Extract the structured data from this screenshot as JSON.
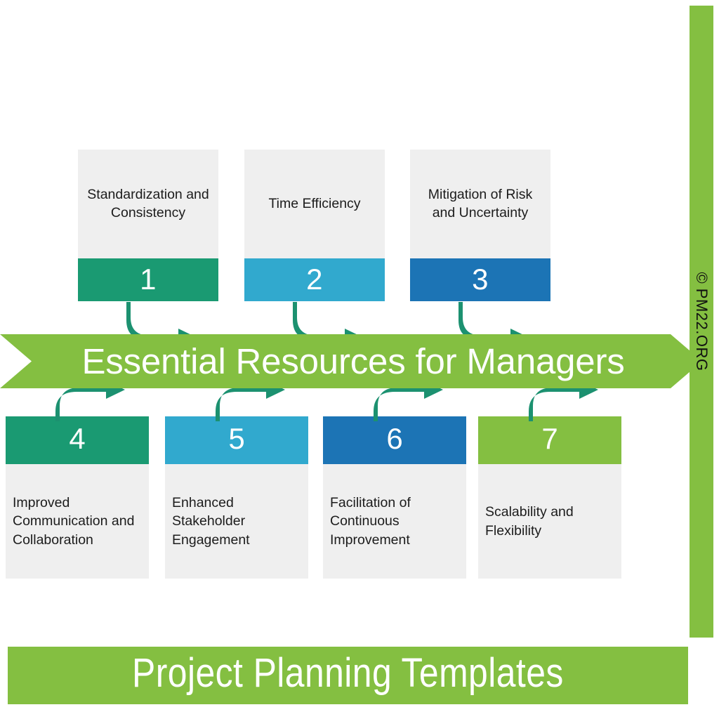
{
  "title": "Essential Resources for Managers",
  "footer": {
    "label": "Project Planning Templates"
  },
  "sidebar": {
    "credit": "© PM22.ORG"
  },
  "colors": {
    "teal": "#1a9a72",
    "cyan": "#31a9ce",
    "blue": "#1c74b5",
    "green": "#84bf41",
    "panel_gray": "#efefef",
    "arrow_teal": "#1c9170",
    "text_dark": "#1c1c1c",
    "text_light": "#ffffff"
  },
  "top_items": [
    {
      "number": "1",
      "label": "Standardization and Consistency",
      "color": "#1a9a72"
    },
    {
      "number": "2",
      "label": "Time Efficiency",
      "color": "#31a9ce"
    },
    {
      "number": "3",
      "label": "Mitigation of Risk and Uncertainty",
      "color": "#1c74b5"
    }
  ],
  "bottom_items": [
    {
      "number": "4",
      "label": "Improved Communication and Collaboration",
      "color": "#1a9a72"
    },
    {
      "number": "5",
      "label": "Enhanced Stakeholder Engagement",
      "color": "#31a9ce"
    },
    {
      "number": "6",
      "label": "Facilitation of Continuous Improvement",
      "color": "#1c74b5"
    },
    {
      "number": "7",
      "label": "Scalability and Flexibility",
      "color": "#84bf41"
    }
  ]
}
